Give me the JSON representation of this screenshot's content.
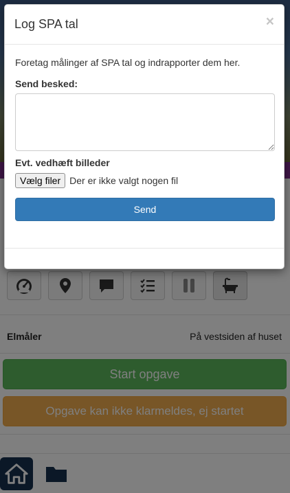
{
  "modal": {
    "title": "Log SPA tal",
    "close_glyph": "×",
    "intro_text": "Foretag målinger af SPA tal og indrapporter dem her.",
    "message_label": "Send besked:",
    "message_value": "",
    "attach_label": "Evt. vedhæft billeder",
    "file_button_label": "Vælg filer",
    "file_status": "Der er ikke valgt nogen fil",
    "send_label": "Send"
  },
  "toolbar": {
    "icons": [
      "gauge-icon",
      "map-marker-icon",
      "comment-icon",
      "checklist-icon",
      "pause-icon",
      "bathtub-icon"
    ]
  },
  "meter": {
    "label": "Elmåler",
    "value": "På vestsiden af huset"
  },
  "actions": {
    "start_label": "Start opgave",
    "cannot_complete_label": "Opgave kan ikke klarmeldes, ej startet"
  },
  "bottom_nav": {
    "icons": [
      "home-icon",
      "folder-icon"
    ]
  },
  "colors": {
    "primary": "#337ab7",
    "success": "#5cb85c",
    "warning": "#f0ad4e",
    "nav_dark": "#16314f"
  }
}
